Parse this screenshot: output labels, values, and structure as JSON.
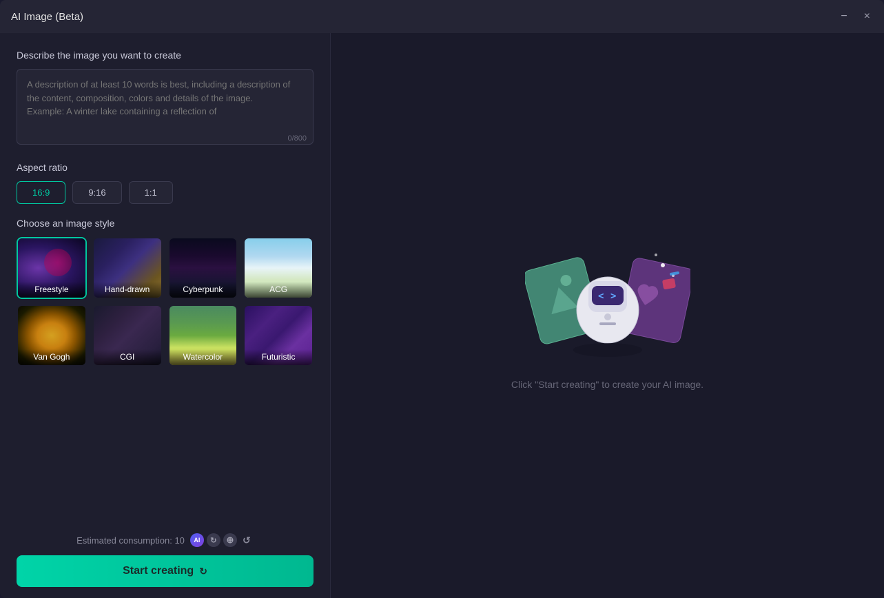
{
  "window": {
    "title": "AI Image (Beta)",
    "minimize_label": "−",
    "close_label": "×"
  },
  "left": {
    "description_label": "Describe the image you want to create",
    "description_placeholder": "A description of at least 10 words is best, including a description of the content, composition, colors and details of the image.\nExample: A winter lake containing a reflection of",
    "char_count": "0/800",
    "aspect_ratio_label": "Aspect ratio",
    "aspect_options": [
      {
        "value": "16:9",
        "active": true
      },
      {
        "value": "9:16",
        "active": false
      },
      {
        "value": "1:1",
        "active": false
      }
    ],
    "style_label": "Choose an image style",
    "styles": [
      {
        "name": "Freestyle",
        "bg": "freestyle",
        "selected": true
      },
      {
        "name": "Hand-drawn",
        "bg": "handdrawn",
        "selected": false
      },
      {
        "name": "Cyberpunk",
        "bg": "cyberpunk",
        "selected": false
      },
      {
        "name": "ACG",
        "bg": "acg",
        "selected": false
      },
      {
        "name": "Van Gogh",
        "bg": "vangogh",
        "selected": false
      },
      {
        "name": "CGI",
        "bg": "cgi",
        "selected": false
      },
      {
        "name": "Watercolor",
        "bg": "watercolor",
        "selected": false
      },
      {
        "name": "Futuristic",
        "bg": "futuristic",
        "selected": false
      }
    ],
    "consumption_label": "Estimated consumption: 10",
    "start_button": "Start creating"
  },
  "right": {
    "hint": "Click \"Start creating\" to create your AI image."
  }
}
